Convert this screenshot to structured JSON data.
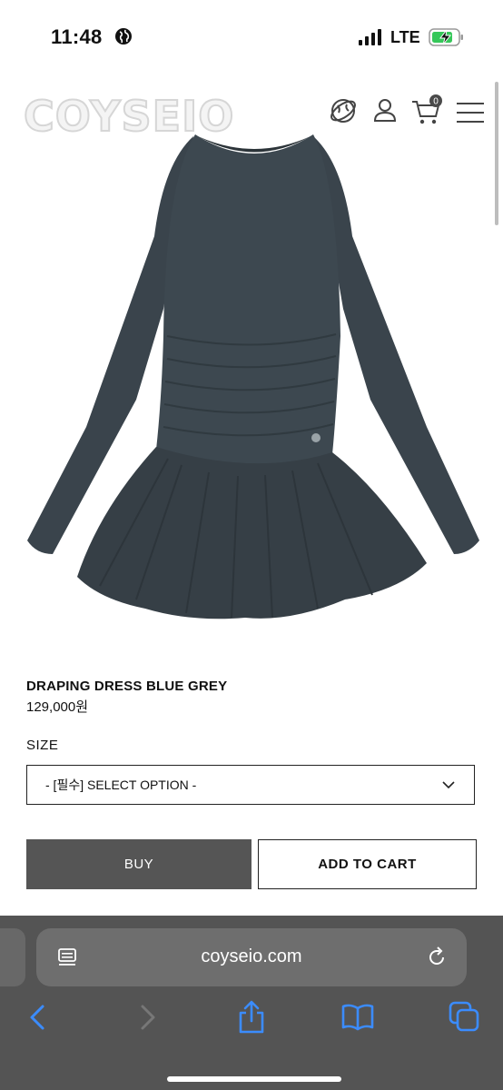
{
  "status_bar": {
    "time": "11:48",
    "network": "LTE",
    "icons": [
      "globe-icon",
      "signal-icon",
      "battery-charging-icon"
    ]
  },
  "header": {
    "logo_text": "COYSEIO",
    "cart_count": "0",
    "icons": [
      "globe-icon",
      "user-icon",
      "cart-icon",
      "menu-icon"
    ]
  },
  "product": {
    "name": "DRAPING DRESS BLUE GREY",
    "price": "129,000원",
    "image": "dress-image"
  },
  "options": {
    "size_label": "SIZE",
    "size_select_value": "- [필수] SELECT OPTION -"
  },
  "actions": {
    "buy_label": "BUY",
    "add_to_cart_label": "ADD TO CART"
  },
  "browser": {
    "url": "coyseio.com",
    "toolbar_icons": [
      "back-icon",
      "forward-icon",
      "share-icon",
      "bookmarks-icon",
      "tabs-icon"
    ]
  },
  "colors": {
    "buy_button": "#555555",
    "browser_chrome": "#545454",
    "browser_accent": "#3b8cff",
    "dress": "#3a444c"
  }
}
